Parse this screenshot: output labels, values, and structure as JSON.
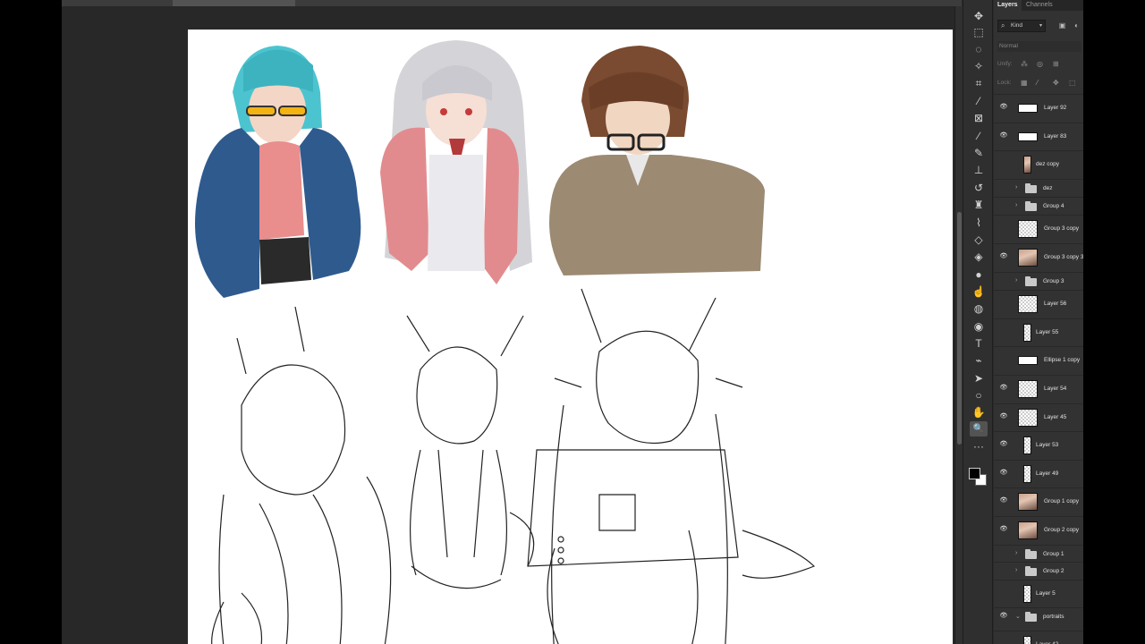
{
  "panel": {
    "tabs": [
      "Layers",
      "Channels"
    ],
    "filter_kind": "Kind",
    "blend_mode": "Normal",
    "unify_label": "Unify:",
    "lock_label": "Lock:"
  },
  "layers": [
    {
      "name": "Layer 92",
      "visible": true
    },
    {
      "name": "Layer 83",
      "visible": true
    },
    {
      "name": "dez copy",
      "visible": false
    },
    {
      "name": "dez",
      "visible": false,
      "group": true
    },
    {
      "name": "Group 4",
      "visible": false,
      "group": true
    },
    {
      "name": "Group 3 copy",
      "visible": false
    },
    {
      "name": "Group 3 copy 3",
      "visible": true
    },
    {
      "name": "Group 3",
      "visible": false,
      "group": true
    },
    {
      "name": "Layer 56",
      "visible": false
    },
    {
      "name": "Layer 55",
      "visible": false
    },
    {
      "name": "Ellipse 1 copy",
      "visible": false
    },
    {
      "name": "Layer 54",
      "visible": true
    },
    {
      "name": "Layer 45",
      "visible": true
    },
    {
      "name": "Layer 53",
      "visible": true
    },
    {
      "name": "Layer 49",
      "visible": true
    },
    {
      "name": "Group 1 copy",
      "visible": true
    },
    {
      "name": "Group 2 copy",
      "visible": true
    },
    {
      "name": "Group 1",
      "visible": false,
      "group": true
    },
    {
      "name": "Group 2",
      "visible": false,
      "group": true
    },
    {
      "name": "Layer 5",
      "visible": false
    },
    {
      "name": "portraits",
      "visible": true,
      "group": true,
      "expanded": true
    },
    {
      "name": "Layer 42",
      "visible": false
    }
  ],
  "tools": [
    {
      "icon": "move-icon",
      "glyph": "✥"
    },
    {
      "icon": "marquee-icon",
      "glyph": "⬚"
    },
    {
      "icon": "lasso-icon",
      "glyph": "◌"
    },
    {
      "icon": "magic-wand-icon",
      "glyph": "✧"
    },
    {
      "icon": "crop-icon",
      "glyph": "⌗"
    },
    {
      "icon": "eyedropper-icon",
      "glyph": "⁄"
    },
    {
      "icon": "frame-icon",
      "glyph": "⊠"
    },
    {
      "icon": "brush-icon",
      "glyph": "∕"
    },
    {
      "icon": "pencil-icon",
      "glyph": "✎"
    },
    {
      "icon": "clone-stamp-icon",
      "glyph": "⊥"
    },
    {
      "icon": "history-brush-icon",
      "glyph": "↺"
    },
    {
      "icon": "stamp-icon",
      "glyph": "♜"
    },
    {
      "icon": "mixer-brush-icon",
      "glyph": "⌇"
    },
    {
      "icon": "eraser-icon",
      "glyph": "◇"
    },
    {
      "icon": "paint-bucket-icon",
      "glyph": "◈"
    },
    {
      "icon": "blur-icon",
      "glyph": "●"
    },
    {
      "icon": "smudge-icon",
      "glyph": "☝"
    },
    {
      "icon": "dodge-icon",
      "glyph": "◍"
    },
    {
      "icon": "pen-icon",
      "glyph": "◉"
    },
    {
      "icon": "type-icon",
      "glyph": "T"
    },
    {
      "icon": "path-select-icon",
      "glyph": "⌁"
    },
    {
      "icon": "direct-select-icon",
      "glyph": "➤"
    },
    {
      "icon": "ellipse-icon",
      "glyph": "○"
    },
    {
      "icon": "hand-icon",
      "glyph": "✋"
    },
    {
      "icon": "zoom-icon",
      "glyph": "🔍"
    },
    {
      "icon": "more-tools-icon",
      "glyph": "···"
    }
  ]
}
